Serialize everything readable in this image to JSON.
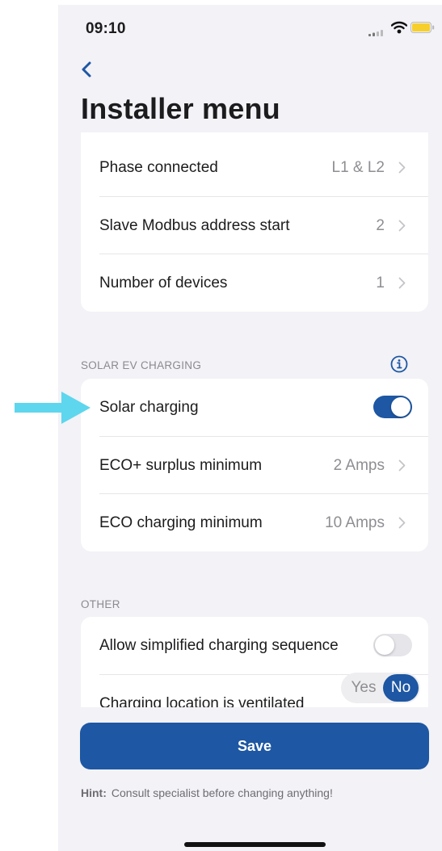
{
  "status_bar": {
    "time": "09:10"
  },
  "header": {
    "title": "Installer menu"
  },
  "sections": {
    "top": {
      "rows": [
        {
          "label": "Phase connected",
          "value": "L1 & L2"
        },
        {
          "label": "Slave Modbus address start",
          "value": "2"
        },
        {
          "label": "Number of devices",
          "value": "1"
        }
      ]
    },
    "solar": {
      "header": "SOLAR EV CHARGING",
      "solar_charging_label": "Solar charging",
      "solar_charging_on": true,
      "rows": [
        {
          "label": "ECO+ surplus minimum",
          "value": "2 Amps"
        },
        {
          "label": "ECO charging minimum",
          "value": "10 Amps"
        }
      ]
    },
    "other": {
      "header": "OTHER",
      "simplified_label": "Allow simplified charging sequence",
      "simplified_on": false,
      "ventilated_label": "Charging location is ventilated",
      "yes_label": "Yes",
      "no_label": "No"
    }
  },
  "save_label": "Save",
  "hint": {
    "label": "Hint:",
    "text": "Consult specialist before changing anything!"
  },
  "colors": {
    "accent": "#1e57a3",
    "arrow": "#5ed6ee",
    "background": "#f2f2f7"
  },
  "icons": [
    "back-chevron-icon",
    "chevron-right-icon",
    "info-icon",
    "signal-icon",
    "wifi-icon",
    "battery-icon",
    "pointer-arrow-icon"
  ]
}
